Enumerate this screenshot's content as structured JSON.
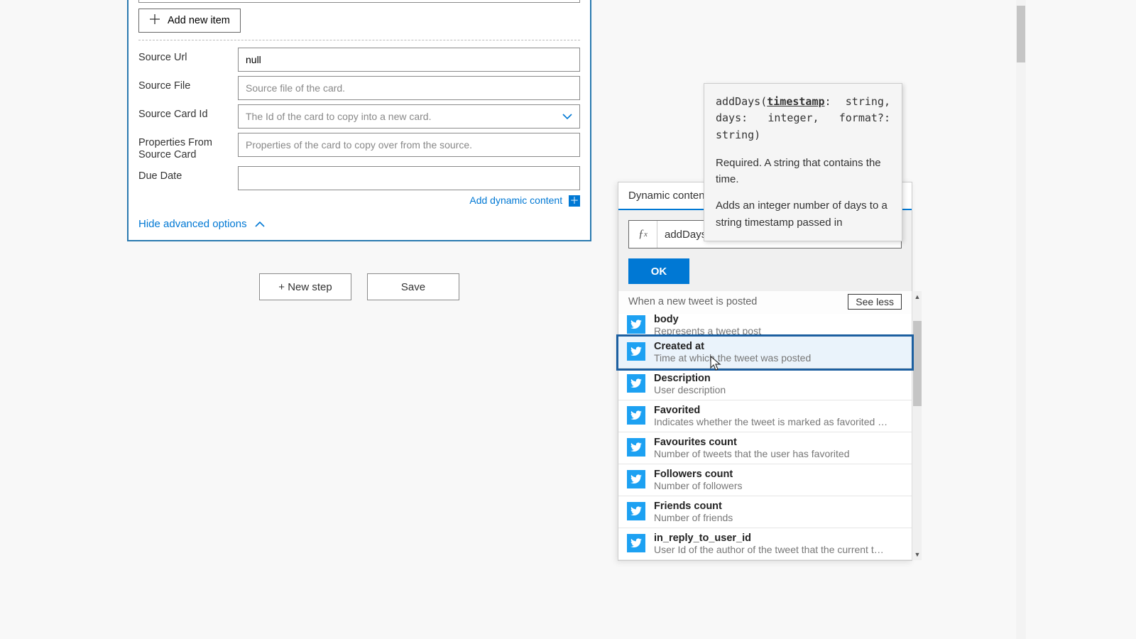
{
  "card": {
    "add_new_item": "Add new item",
    "fields": [
      {
        "label": "Source Url",
        "value": "null",
        "placeholder": "",
        "type": "text"
      },
      {
        "label": "Source File",
        "value": "",
        "placeholder": "Source file of the card.",
        "type": "text"
      },
      {
        "label": "Source Card Id",
        "value": "",
        "placeholder": "The Id of the card to copy into a new card.",
        "type": "select"
      },
      {
        "label": "Properties From Source Card",
        "value": "",
        "placeholder": "Properties of the card to copy over from the source.",
        "type": "text"
      },
      {
        "label": "Due Date",
        "value": "",
        "placeholder": "",
        "type": "text"
      }
    ],
    "dynamic_link": "Add dynamic content",
    "advanced": "Hide advanced options"
  },
  "footer": {
    "new_step": "+ New step",
    "save": "Save"
  },
  "popout": {
    "header": "Dynamic content",
    "expr": "addDays(",
    "ok": "OK",
    "section": "When a new tweet is posted",
    "see_less": "See less",
    "items": [
      {
        "title": "body",
        "desc": "Represents a tweet post",
        "selected": false,
        "clipped_top": true
      },
      {
        "title": "Created at",
        "desc": "Time at which the tweet was posted",
        "selected": true
      },
      {
        "title": "Description",
        "desc": "User description",
        "clipped_top_minor": true
      },
      {
        "title": "Favorited",
        "desc": "Indicates whether the tweet is marked as favorited or not"
      },
      {
        "title": "Favourites count",
        "desc": "Number of tweets that the user has favorited"
      },
      {
        "title": "Followers count",
        "desc": "Number of followers"
      },
      {
        "title": "Friends count",
        "desc": "Number of friends"
      },
      {
        "title": "in_reply_to_user_id",
        "desc": "User Id of the author of the tweet that the current tweet i..."
      }
    ]
  },
  "tooltip": {
    "sig_pre": "addDays(",
    "sig_param": "timestamp",
    "sig_post1": ": string,",
    "sig_post2": "days: integer, format?: string)",
    "para1": "Required. A string that contains the time.",
    "para2": "Adds an integer number of days to a string timestamp passed in"
  }
}
